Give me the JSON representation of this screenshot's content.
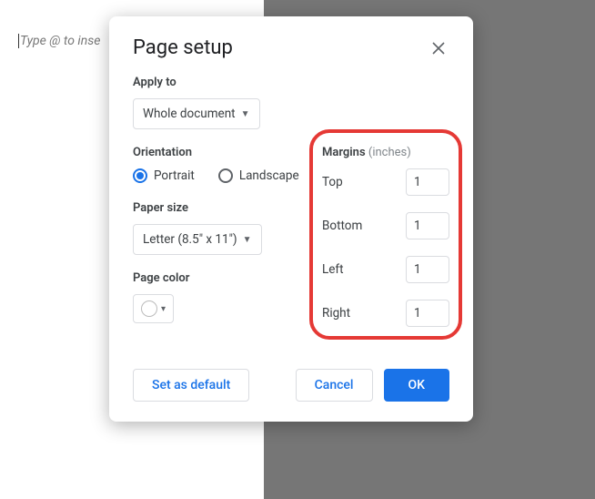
{
  "doc": {
    "placeholder": "Type @ to inse"
  },
  "dialog": {
    "title": "Page setup",
    "apply_to": {
      "label": "Apply to",
      "value": "Whole document"
    },
    "orientation": {
      "label": "Orientation",
      "portrait": "Portrait",
      "landscape": "Landscape",
      "selected": "portrait"
    },
    "paper_size": {
      "label": "Paper size",
      "value": "Letter (8.5\" x 11\")"
    },
    "page_color": {
      "label": "Page color"
    },
    "margins": {
      "label": "Margins",
      "unit": "(inches)",
      "top_label": "Top",
      "top_value": "1",
      "bottom_label": "Bottom",
      "bottom_value": "1",
      "left_label": "Left",
      "left_value": "1",
      "right_label": "Right",
      "right_value": "1"
    },
    "buttons": {
      "set_default": "Set as default",
      "cancel": "Cancel",
      "ok": "OK"
    }
  }
}
